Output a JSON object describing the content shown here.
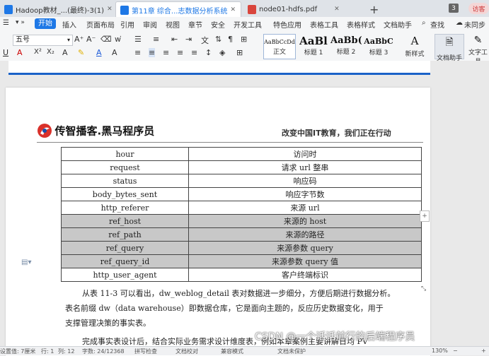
{
  "tabs": [
    {
      "label": "Hadoop教材_...(最终)-3(1)",
      "icon_color": "#1e78e6"
    },
    {
      "label": "第11章 综合...志数据分析系统",
      "icon_color": "#1e78e6"
    },
    {
      "label": "node01-hdfs.pdf",
      "icon_color": "#d9453c"
    }
  ],
  "tab_badge": "3",
  "visitor_label": "访客",
  "menu": {
    "start": "开始",
    "items": [
      "插入",
      "页面布局",
      "引用",
      "审阅",
      "视图",
      "章节",
      "安全",
      "开发工具",
      "特色应用",
      "表格工具",
      "表格样式",
      "文档助手"
    ],
    "search": "查找",
    "sync": "未同步"
  },
  "ribbon": {
    "font_size": "五号",
    "styles": [
      {
        "preview": "AaBbCcDd",
        "label": "正文"
      },
      {
        "preview": "AaBl",
        "label": "标题 1"
      },
      {
        "preview": "AaBb(",
        "label": "标题 2"
      },
      {
        "preview": "AaBbC",
        "label": "标题 3"
      }
    ],
    "new_style": "新样式",
    "doc_assistant": "文档助手",
    "text_tools": "文字工具"
  },
  "document": {
    "logo_text": "传智播客.黑马程序员",
    "slogan": "改变中国IT教育，我们正在行动",
    "table_rows": [
      {
        "field": "hour",
        "desc": "访问时",
        "highlight": false
      },
      {
        "field": "request",
        "desc": "请求 url 整串",
        "highlight": false
      },
      {
        "field": "status",
        "desc": "响应码",
        "highlight": false
      },
      {
        "field": "body_bytes_sent",
        "desc": "响应字节数",
        "highlight": false
      },
      {
        "field": "http_referer",
        "desc": "来源 url",
        "highlight": false
      },
      {
        "field": "ref_host",
        "desc": "来源的 host",
        "highlight": true
      },
      {
        "field": "ref_path",
        "desc": "来源的路径",
        "highlight": true
      },
      {
        "field": "ref_query",
        "desc": "来源参数 query",
        "highlight": true
      },
      {
        "field": "ref_query_id",
        "desc": "来源参数 query 值",
        "highlight": true
      },
      {
        "field": "http_user_agent",
        "desc": "客户终端标识",
        "highlight": false
      }
    ],
    "para1_line1": "从表 11-3 可以看出，dw_weblog_detail 表对数据进一步细分，方便后期进行数据分析。",
    "para1_line2": "表名前缀 dw（data warehouse）即数据仓库，它是面向主题的，反应历史数据变化，用于",
    "para1_line3": "支撑管理决策的事实表。",
    "para2_line1": "完成事实表设计后，结合实际业务需求设计维度表，例如本章案例主要讲解日均 PV"
  },
  "status": {
    "position": "设置值: 7厘米",
    "row": "行: 1",
    "col": "列: 12",
    "wordcount": "字数: 24/12368",
    "spell": "拼写检查",
    "proof": "文档校对",
    "compat": "兼容模式",
    "missing_font": "文档未保护",
    "zoom": "130%"
  },
  "watermark": "CSDN @一个话话前行的后端程序员",
  "colors": {
    "accent": "#1e78e6",
    "highlight_row": "#c8c8c8",
    "page_rule": "#1a62c8"
  }
}
